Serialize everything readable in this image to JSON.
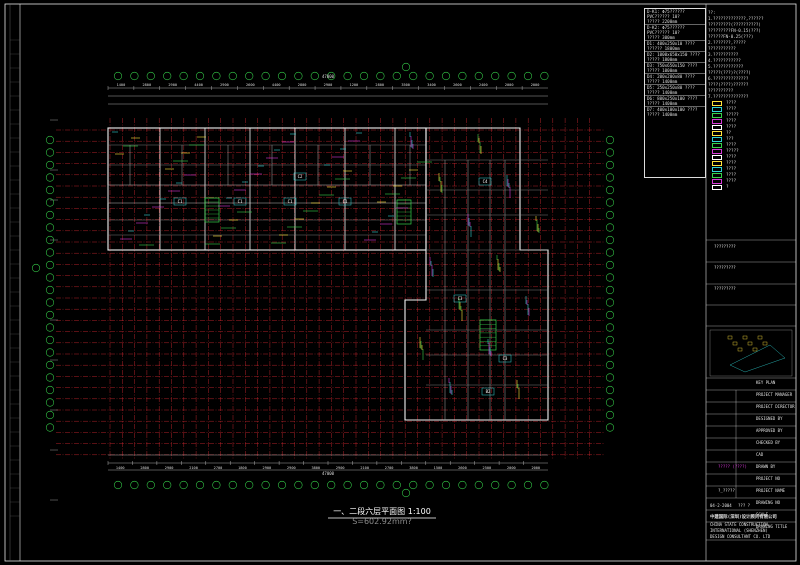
{
  "drawing": {
    "title": "一、二段六层平面图",
    "scale": "1:100",
    "area": "S=602.92mm?",
    "overall_dimension_top": "47000",
    "overall_dimension_bottom": "47000",
    "top_dims": [
      "1400",
      "2800",
      "2900",
      "4400",
      "2900",
      "2600",
      "4400",
      "2800",
      "2900",
      "1200",
      "2800",
      "3500",
      "3400",
      "2600",
      "2400",
      "2000",
      "2000"
    ],
    "bottom_dims": [
      "1400",
      "2800",
      "2900",
      "2100",
      "2700",
      "1800",
      "2900",
      "2900",
      "3800",
      "2900",
      "2100",
      "2700",
      "3800",
      "1500",
      "2600",
      "2500",
      "2000",
      "2000"
    ],
    "room_labels": [
      "C1",
      "C1",
      "C1",
      "C1",
      "C2",
      "C4",
      "C3",
      "C3",
      "B2"
    ],
    "colors": {
      "background": "#000000",
      "grid_red": "#c4262e",
      "wall_white": "#f2f2f2",
      "cyan": "#2fd3d3",
      "green": "#36d14a",
      "yellow": "#ffe23a",
      "magenta": "#d538d5"
    }
  },
  "notes": {
    "lines": [
      "D-K1: Φ75??????",
      "  PVC?????? 10?",
      "  ????? 2200mm",
      "D-K2: Φ75??????",
      "  PVC?????? 10?",
      "  ????? 300mm",
      "D1: 400x250x10 ????",
      "  ?????? 1800mm",
      "D2: 1000x650x150 ????",
      "  ????? 1800mm",
      "D3: 750x650x150 ????",
      "  ????? 1000mm",
      "D4: 200x200x80 ????",
      "  ????? 1400mm",
      "D5: 250x250x80 ????",
      "  ????? 1400mm",
      "D6: 800x250x100 ????",
      "  ????? 1400mm",
      "D7: 400x100x100 ????",
      "  ????? 1400mm"
    ]
  },
  "legend": {
    "lines": [
      "??:",
      "1.?????????????,??????",
      "  ?????????(??????????)",
      "  ?????????FN-0.15(???)",
      "  ??????FN-0.25(???)",
      "2.???????,?????",
      "  ???????????",
      "3.??????????",
      "4.???????????",
      "5.????????????",
      "  ?????(???)?(????)",
      "6.??????????????",
      "  ????(????)??????",
      "  ??????????",
      "7.??????????????"
    ],
    "symbols": [
      "????",
      "????",
      "?????",
      "????",
      "????",
      "??",
      "???",
      "????",
      "?????",
      "????",
      "????",
      "????",
      "????",
      "????",
      "?"
    ]
  },
  "title_block": {
    "rows": [
      "?????????",
      "?????????",
      "?????????"
    ],
    "fields": [
      "KEY PLAN",
      "PROJECT MANAGER",
      "PROJECT DIRECTOR",
      "DESIGNED BY",
      "APPROVED BY",
      "CHECKED BY",
      "CAD",
      "DRAWN BY",
      "PROJECT NO",
      "PROJECT NAME",
      "DRAWING NO",
      "SCALE",
      "DRAWING TITLE"
    ],
    "project_name": "????? (????)",
    "drawing_title": "?_?????",
    "date": "04-2-2004",
    "sheet": "??? ?",
    "company_cn": "中建国际(深圳)设计顾问有限公司",
    "company_en_1": "CHINA STATE CONSTRUCTION",
    "company_en_2": "INTERNATIONAL (SHENZHEN)",
    "company_en_3": "DESIGN CONSULTANT CO. LTD"
  }
}
